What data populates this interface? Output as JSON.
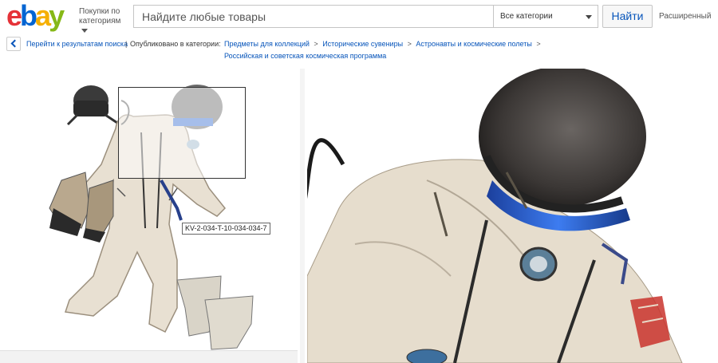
{
  "header": {
    "logo_text": "ebay",
    "shop_by_category": "Покупки по категориям",
    "search_placeholder": "Найдите любые товары",
    "category_select": "Все категории",
    "search_button": "Найти",
    "advanced_link": "Расширенный"
  },
  "breadcrumb": {
    "back_link": "Перейти к результатам поиска",
    "separator": "|",
    "published_in": "Опубликовано в категории:",
    "items": [
      "Предметы для коллекций",
      "Исторические сувениры",
      "Астронавты и космические полеты"
    ],
    "last_item": "Российская и советская космическая программа",
    "chevron": ">"
  },
  "viewer": {
    "tooltip": "KV-2-034-T-10-034-034-7"
  },
  "colors": {
    "ebay_red": "#e53238",
    "ebay_blue": "#0064d2",
    "ebay_yellow": "#f5af02",
    "ebay_green": "#86b817",
    "link": "#0654ba"
  },
  "icons": {
    "back": "chevron-left-icon",
    "dropdown": "caret-down-icon"
  }
}
